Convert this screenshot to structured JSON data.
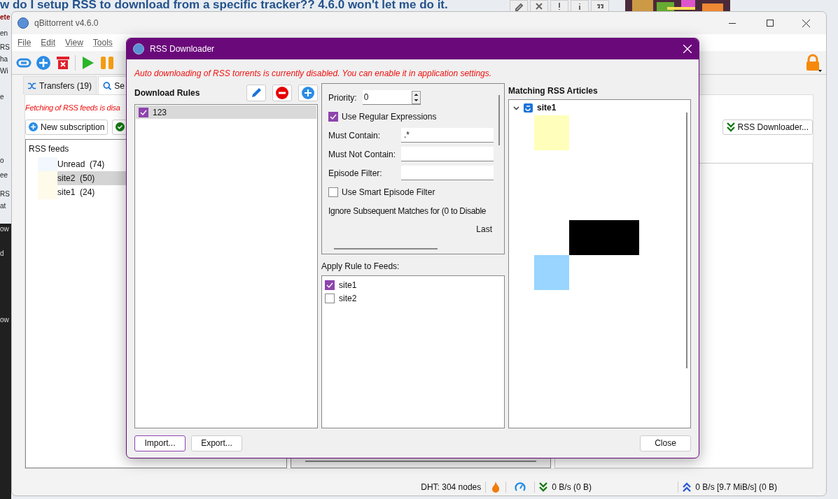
{
  "background_page": {
    "heading": "w do I setup RSS to download from a specific tracker?? 4.6.0 won't let me do it.",
    "author": "ete",
    "side_fragments": [
      "en",
      "RS",
      "ha",
      "Wi",
      "e",
      "o",
      "ee",
      "RS",
      "at",
      "ow",
      "d",
      "ow"
    ]
  },
  "main_window": {
    "title": "qBittorrent v4.6.0",
    "menu": [
      "File",
      "Edit",
      "View",
      "Tools"
    ],
    "tabs": [
      {
        "label": "Transfers (19)",
        "selected": false
      },
      {
        "label": "Se",
        "selected": true
      }
    ],
    "notice": "Fetching of RSS feeds is disa",
    "new_subscription": "New subscription",
    "feeds_header": "RSS feeds",
    "feeds": [
      {
        "label": "Unread  (74)",
        "selected": false,
        "color": "#f2f8fd"
      },
      {
        "label": "site2  (50)",
        "selected": true,
        "color": "#fffbea"
      },
      {
        "label": "site1  (24)",
        "selected": false,
        "color": "#fffbea"
      }
    ],
    "rss_downloader_button": "RSS Downloader...",
    "status_bar": {
      "dht": "DHT: 304 nodes",
      "download": "0 B/s (0 B)",
      "upload": "0 B/s [9.7 MiB/s] (0 B)"
    }
  },
  "dialog": {
    "title": "RSS Downloader",
    "warning": "Auto downloading of RSS torrents is currently disabled. You can enable it in application settings.",
    "rules_header": "Download Rules",
    "rules": [
      {
        "label": "123",
        "checked": true,
        "selected": true
      }
    ],
    "rule_form": {
      "priority_label": "Priority:",
      "priority_value": "0",
      "use_regex": {
        "label": "Use Regular Expressions",
        "checked": true
      },
      "must_contain": {
        "label": "Must Contain:",
        "value": ".*"
      },
      "must_not_contain": {
        "label": "Must Not Contain:"
      },
      "episode_filter": {
        "label": "Episode Filter:"
      },
      "smart_filter": {
        "label": "Use Smart Episode Filter",
        "checked": false
      },
      "ignore_label": "Ignore Subsequent Matches for (0 to Disable",
      "last_label": "Last"
    },
    "feeds_header": "Apply Rule to Feeds:",
    "feeds": [
      {
        "label": "site1",
        "checked": true
      },
      {
        "label": "site2",
        "checked": false
      }
    ],
    "articles_header": "Matching RSS Articles",
    "articles": [
      {
        "label": "site1",
        "expanded": true
      }
    ],
    "import_button": "Import...",
    "export_button": "Export...",
    "close_button": "Close"
  }
}
